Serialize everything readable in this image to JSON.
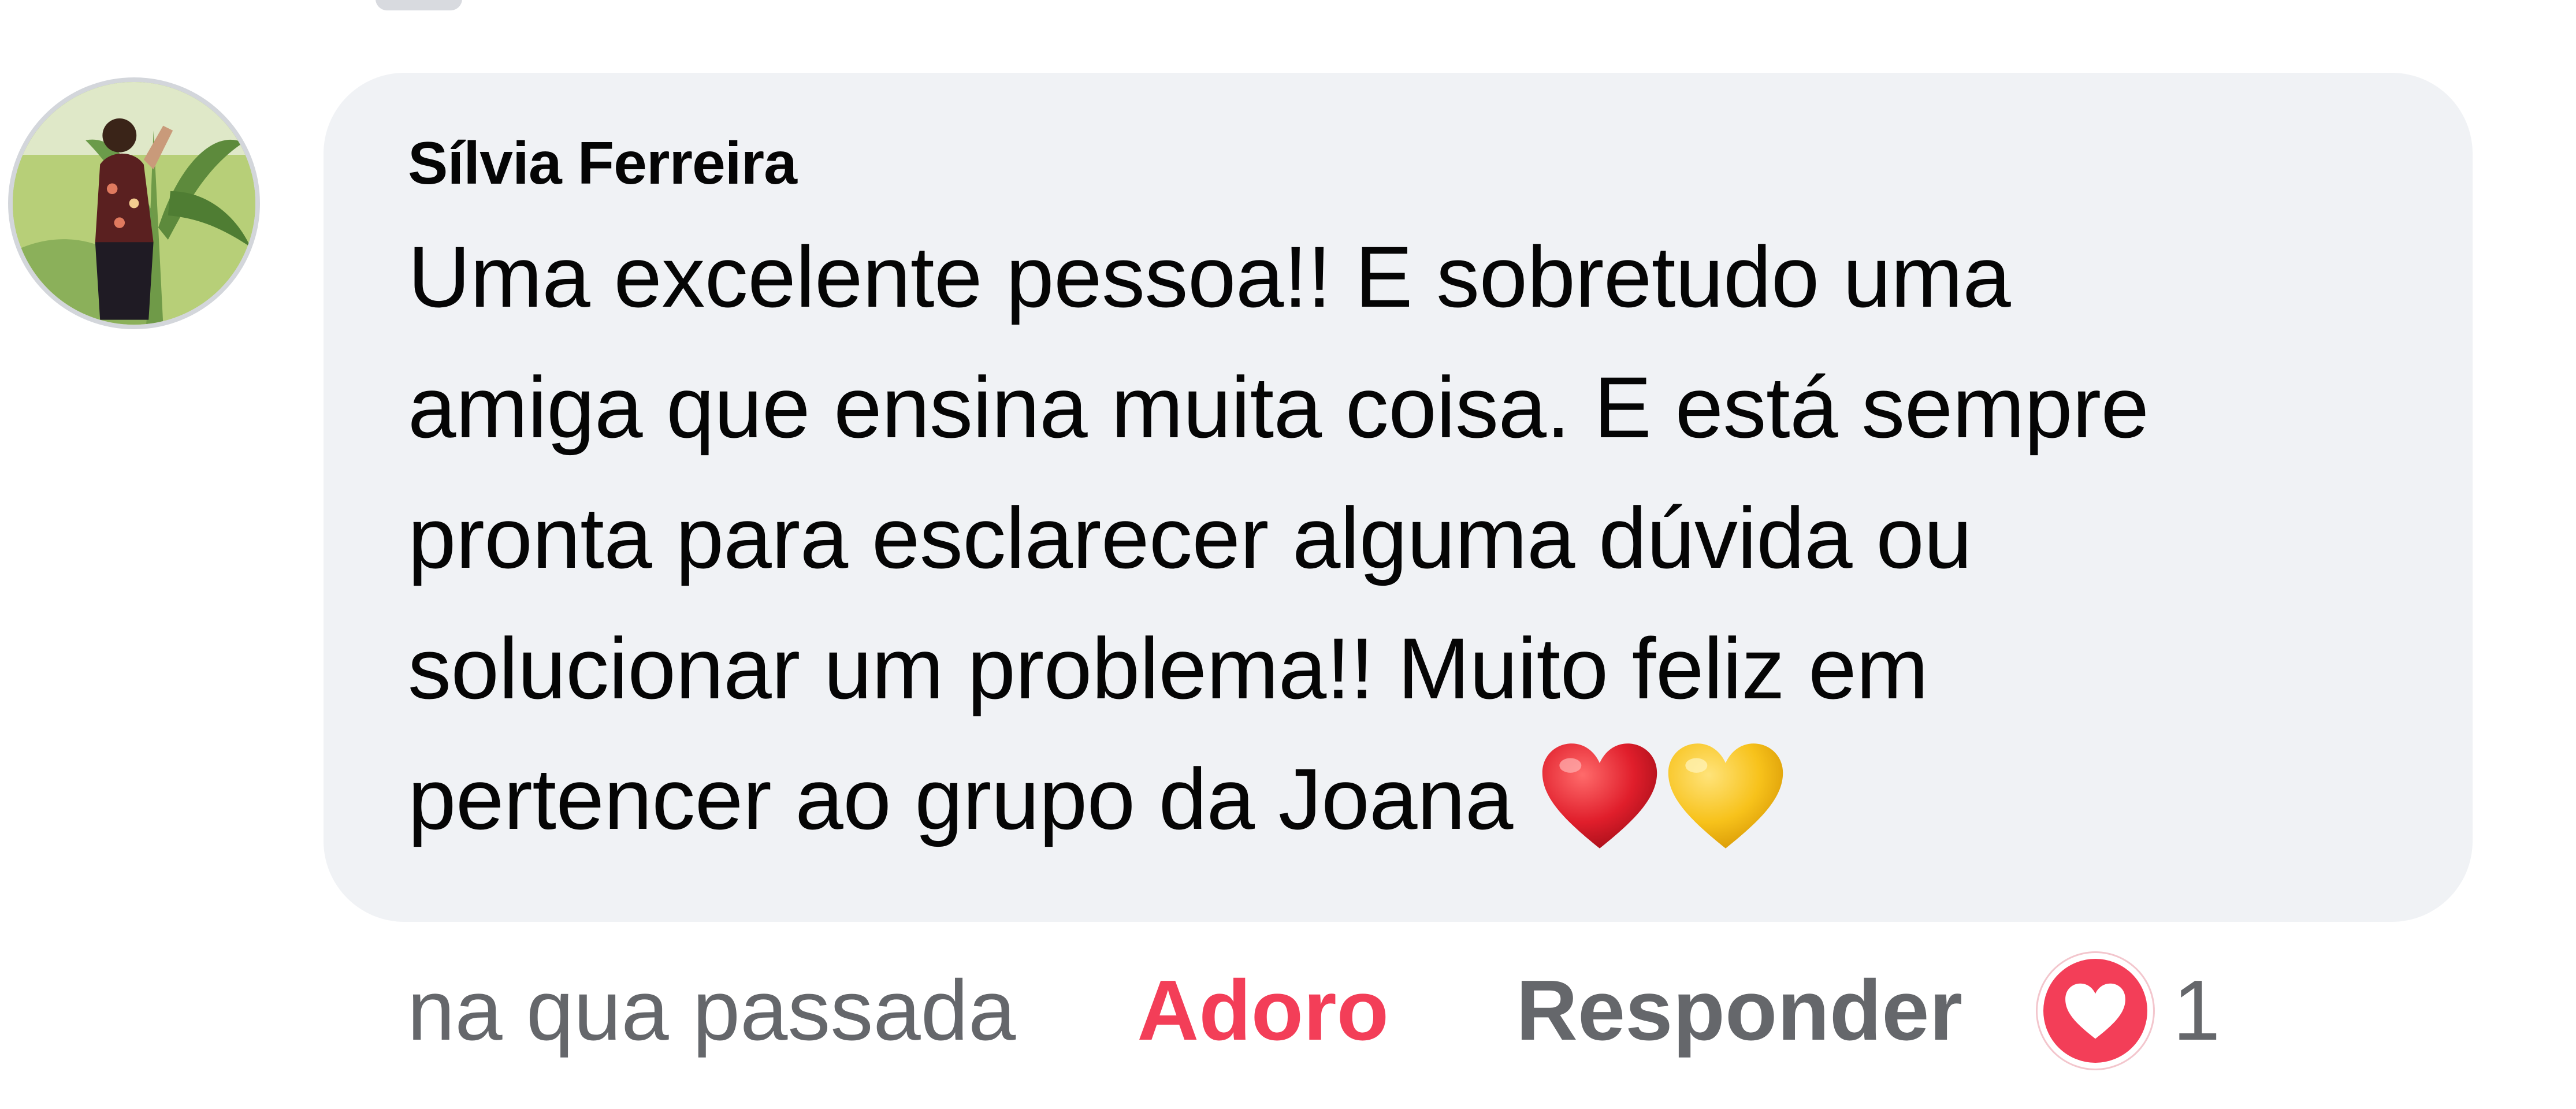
{
  "comment": {
    "author": "Sílvia Ferreira",
    "text_lines": [
      "Uma excelente pessoa!! E sobretudo uma",
      "amiga que ensina muita coisa. E está sempre",
      "pronta para esclarecer alguma dúvida ou",
      "solucionar um problema!! Muito feliz em",
      "pertencer ao grupo da Joana"
    ],
    "emojis": [
      "red-heart-icon",
      "yellow-heart-icon"
    ]
  },
  "meta": {
    "timestamp": "na qua passada",
    "react_label": "Adoro",
    "reply_label": "Responder",
    "reaction_icon": "love-reaction-icon",
    "reaction_count": "1"
  },
  "colors": {
    "bubble": "#f0f2f5",
    "love": "#f33e58",
    "secondary_text": "#65676b",
    "primary_text": "#050505"
  }
}
